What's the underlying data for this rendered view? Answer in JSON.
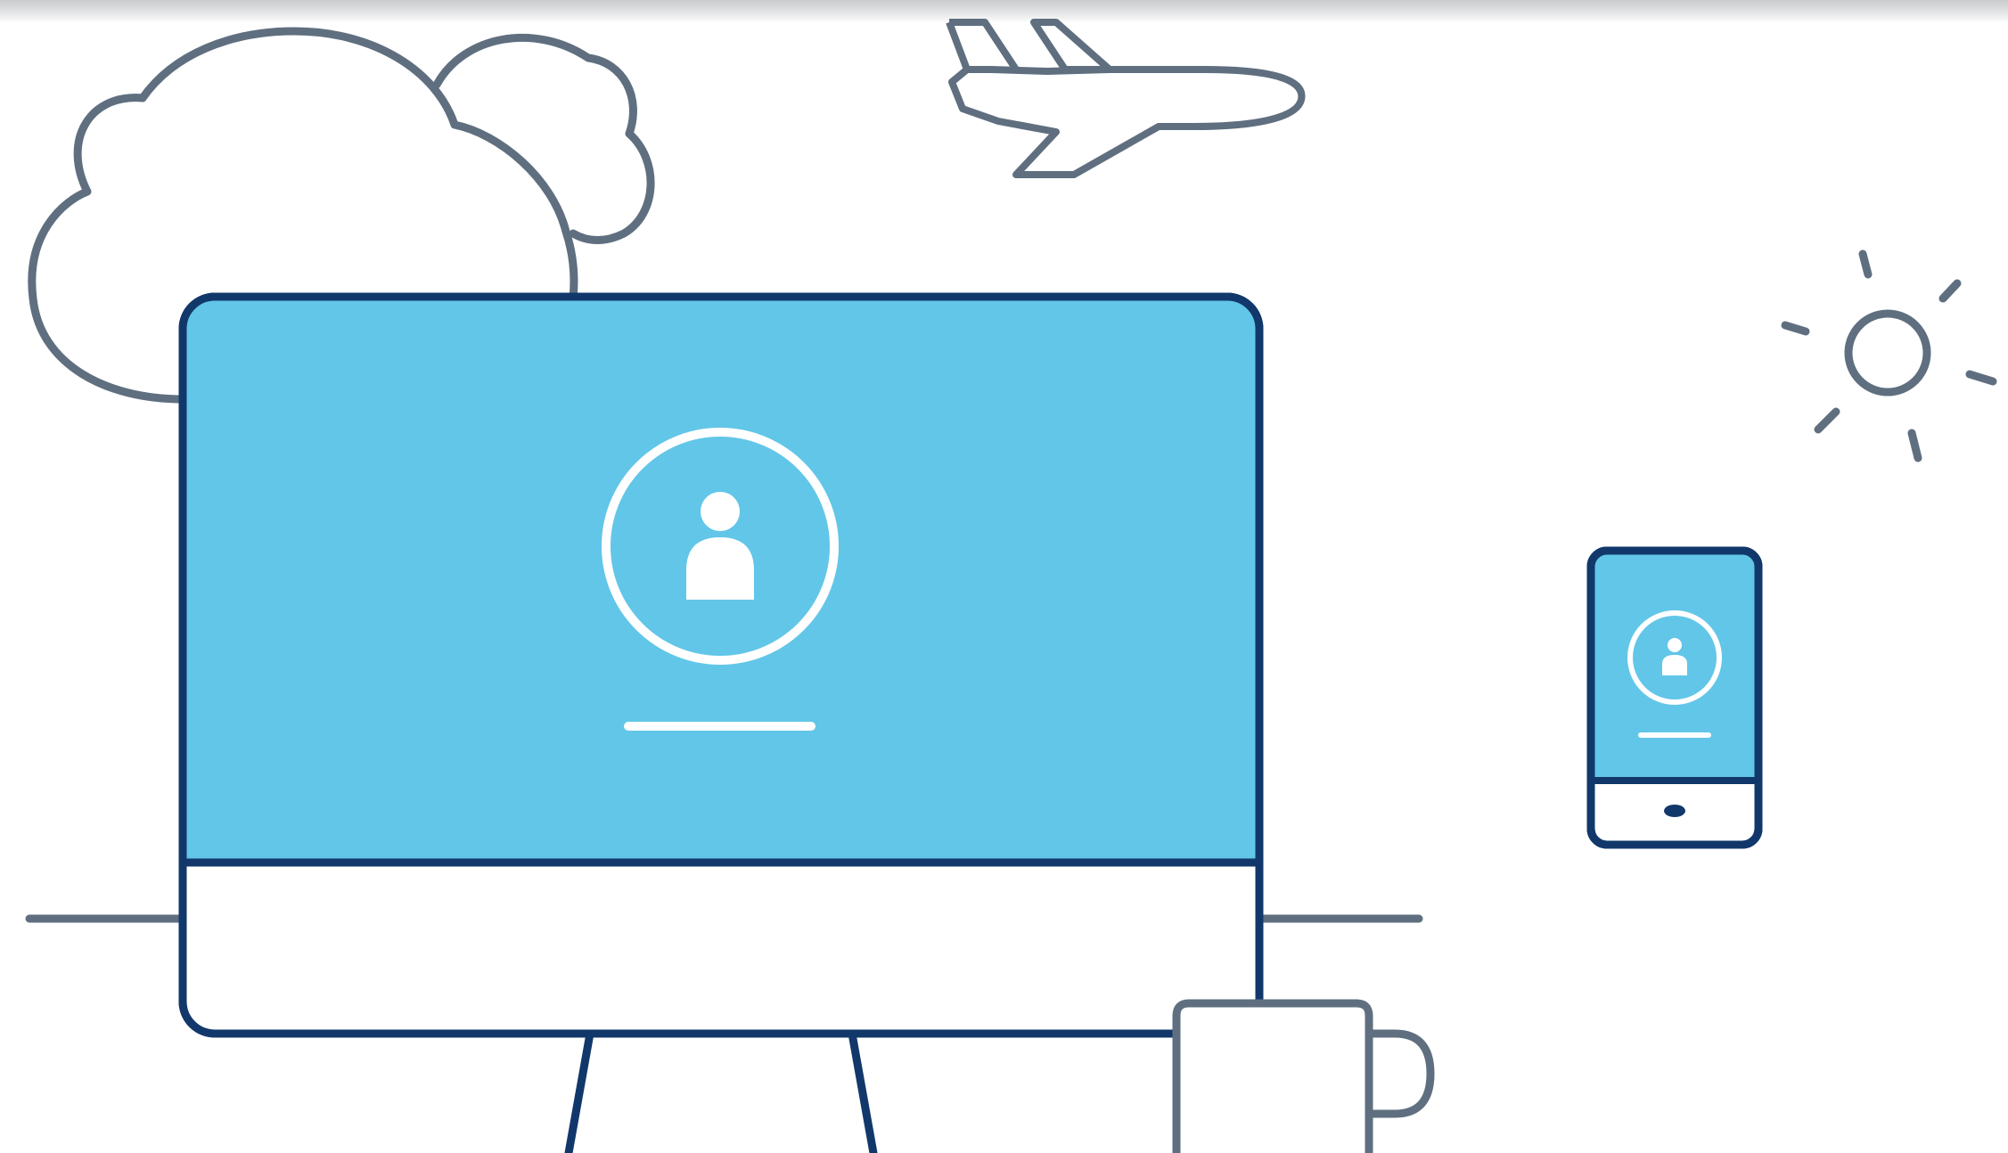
{
  "illustration": {
    "colors": {
      "background": "#ffffff",
      "outline_gray": "#5f6f80",
      "outline_navy": "#12386b",
      "screen_blue": "#62c6e8",
      "white": "#ffffff"
    },
    "icons": [
      "cloud-icon",
      "airplane-icon",
      "sun-icon",
      "desktop-monitor-icon",
      "user-avatar-icon",
      "smartphone-icon",
      "coffee-mug-icon"
    ]
  }
}
